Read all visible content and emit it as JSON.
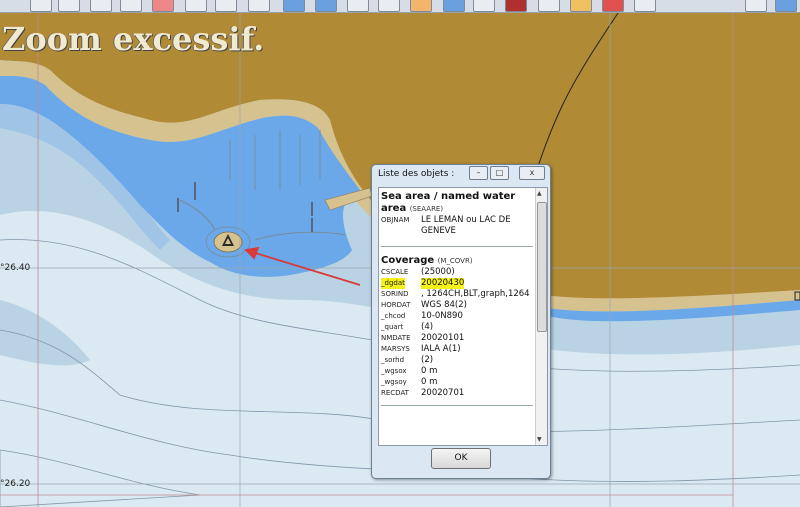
{
  "map": {
    "zoom_message": "Zoom excessif.",
    "lat_labels": [
      "°26.40",
      "°26.20"
    ],
    "colors": {
      "land": "#b08a35",
      "shore": "#d6c28f",
      "deep_water": "#dbe9f2",
      "shallow_water": "#b9d3e4",
      "harbor_water": "#6aa8ea",
      "annotation_arrow": "#d93a3a"
    }
  },
  "dialog": {
    "title": "Liste des objets :",
    "buttons": {
      "minimize": "–",
      "maximize": "□",
      "close": "x"
    },
    "sections": [
      {
        "title": "Sea area / named water area",
        "code": "(SEAARE)",
        "rows": [
          {
            "key": "OBJNAM",
            "value": "LE LEMAN ou LAC DE GENEVE"
          }
        ]
      },
      {
        "title": "Coverage",
        "code": "(M_COVR)",
        "rows": [
          {
            "key": "CSCALE",
            "value": "(25000)"
          },
          {
            "key": "_dgdat",
            "value": "20020430",
            "highlight": true
          },
          {
            "key": "SORIND",
            "value": ", 1264CH,BLT,graph,1264"
          },
          {
            "key": "HORDAT",
            "value": "WGS 84(2)"
          },
          {
            "key": "_chcod",
            "value": "10-0N890"
          },
          {
            "key": "_quart",
            "value": "(4)"
          },
          {
            "key": "NMDATE",
            "value": "20020101"
          },
          {
            "key": "MARSYS",
            "value": "IALA A(1)"
          },
          {
            "key": "_sorhd",
            "value": "(2)"
          },
          {
            "key": "_wgsox",
            "value": "0 m"
          },
          {
            "key": "_wgsoy",
            "value": "0 m"
          },
          {
            "key": "RECDAT",
            "value": "20020701"
          }
        ]
      }
    ],
    "ok_label": "OK"
  }
}
